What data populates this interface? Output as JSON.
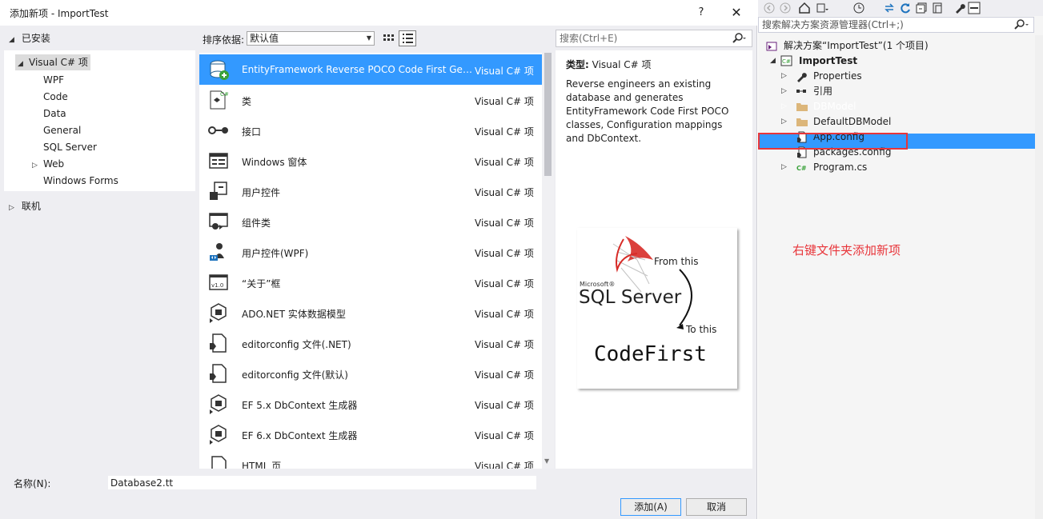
{
  "dialog": {
    "title": "添加新项 - ImportTest",
    "help_label": "?",
    "close_label": "✕",
    "installed_label": "已安装",
    "online_label": "联机",
    "left_tree": [
      {
        "label": "Visual C# 项",
        "expanded": true,
        "selected": true
      },
      {
        "label": "WPF"
      },
      {
        "label": "Code"
      },
      {
        "label": "Data"
      },
      {
        "label": "General"
      },
      {
        "label": "SQL Server"
      },
      {
        "label": "Web",
        "collapsed": true
      },
      {
        "label": "Windows Forms"
      }
    ],
    "sort_label": "排序依据:",
    "sort_value": "默认值",
    "search_placeholder": "搜索(Ctrl+E)",
    "items": [
      {
        "name": "EntityFramework Reverse POCO Code First Gen...",
        "type": "Visual C# 项",
        "icon": "ef-poco-icon",
        "selected": true
      },
      {
        "name": "类",
        "type": "Visual C# 项",
        "icon": "class-icon"
      },
      {
        "name": "接口",
        "type": "Visual C# 项",
        "icon": "interface-icon"
      },
      {
        "name": "Windows 窗体",
        "type": "Visual C# 项",
        "icon": "windows-form-icon"
      },
      {
        "name": "用户控件",
        "type": "Visual C# 项",
        "icon": "user-control-icon"
      },
      {
        "name": "组件类",
        "type": "Visual C# 项",
        "icon": "component-class-icon"
      },
      {
        "name": "用户控件(WPF)",
        "type": "Visual C# 项",
        "icon": "wpf-user-control-icon"
      },
      {
        "name": "“关于”框",
        "type": "Visual C# 项",
        "icon": "about-box-icon"
      },
      {
        "name": "ADO.NET 实体数据模型",
        "type": "Visual C# 项",
        "icon": "ado-entity-model-icon"
      },
      {
        "name": "editorconfig 文件(.NET)",
        "type": "Visual C# 项",
        "icon": "editorconfig-icon"
      },
      {
        "name": "editorconfig 文件(默认)",
        "type": "Visual C# 项",
        "icon": "editorconfig-icon"
      },
      {
        "name": "EF 5.x DbContext 生成器",
        "type": "Visual C# 项",
        "icon": "ef-generator-icon"
      },
      {
        "name": "EF 6.x DbContext 生成器",
        "type": "Visual C# 项",
        "icon": "ef-generator-icon"
      },
      {
        "name": "HTML 页",
        "type": "Visual C# 项",
        "icon": "html-page-icon"
      }
    ],
    "details": {
      "type_label": "类型:",
      "type_value": "Visual C# 项",
      "description": "Reverse engineers an existing database and generates EntityFramework Code First POCO classes, Configuration mappings and DbContext.",
      "preview": {
        "microsoft": "Microsoft®",
        "sql_server": "SQL Server",
        "from_this": "From this",
        "to_this": "To this",
        "code_first": "CodeFirst"
      }
    },
    "name_label": "名称(N):",
    "name_value": "Database2.tt",
    "add_button": "添加(A)",
    "cancel_button": "取消"
  },
  "explorer": {
    "search_placeholder": "搜索解决方案资源管理器(Ctrl+;)",
    "tree": [
      {
        "label": "解决方案“ImportTest”(1 个项目)",
        "icon": "solution-icon"
      },
      {
        "label": "ImportTest",
        "icon": "csharp-project-icon",
        "bold": true
      },
      {
        "label": "Properties",
        "icon": "wrench-icon"
      },
      {
        "label": "引用",
        "icon": "references-icon"
      },
      {
        "label": "DBModel",
        "icon": "folder-icon",
        "selected": true
      },
      {
        "label": "DefaultDBModel",
        "icon": "folder-icon"
      },
      {
        "label": "App.config",
        "icon": "config-file-icon"
      },
      {
        "label": "packages.config",
        "icon": "config-file-icon"
      },
      {
        "label": "Program.cs",
        "icon": "csharp-file-icon"
      }
    ],
    "annotation": "右键文件夹添加新项"
  },
  "colors": {
    "selection": "#3399ff",
    "annotation_red": "#e8353a",
    "dialog_bg": "#eeeef2"
  }
}
